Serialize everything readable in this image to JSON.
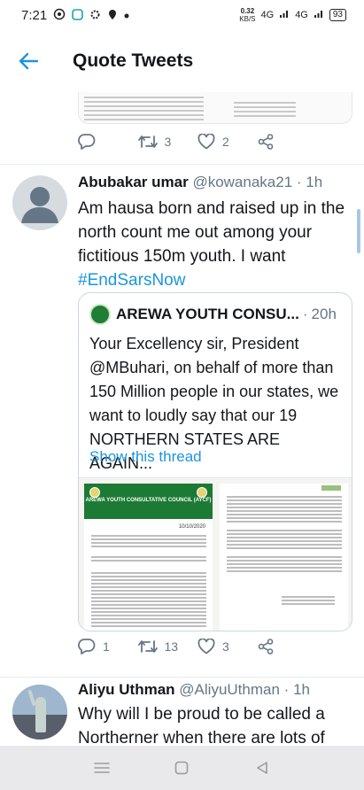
{
  "status_bar": {
    "time": "7:21",
    "speed_value": "0.32",
    "speed_unit": "KB/S",
    "network_1": "4G",
    "network_2": "4G",
    "battery": "93",
    "icons": [
      "whatsapp-icon",
      "app-icon",
      "settings-icon",
      "location-icon",
      "dot-icon"
    ]
  },
  "header": {
    "title": "Quote Tweets",
    "back_icon": "arrow-left-icon"
  },
  "previous_tweet": {
    "reply_count": "",
    "retweet_count": "3",
    "like_count": "2"
  },
  "tweets": [
    {
      "name": "Abubakar umar",
      "handle": "@kowanaka21",
      "separator": "·",
      "time": "1h",
      "text": "Am hausa born and raised up in the north count me out among your fictitious 150m youth. I want",
      "hashtag": "#EndSarsNow",
      "quote": {
        "name": "AREWA YOUTH CONSU...",
        "separator": "·",
        "time": "20h",
        "text": "Your Excellency sir, President @MBuhari, on behalf of more than 150 Million people in our states, we want to loudly say that our 19 NORTHERN STATES ARE AGAIN...",
        "show_thread": "Show this thread",
        "document": {
          "org_name": "AREWA YOUTH CONSULTATIVE COUNCIL (AYCF)",
          "date": "10/10/2020"
        }
      },
      "reply_count": "1",
      "retweet_count": "13",
      "like_count": "3"
    },
    {
      "name": "Aliyu Uthman",
      "handle": "@AliyuUthman",
      "separator": "·",
      "time": "1h",
      "text": "Why will I be proud to be called a Northerner when there are lots of people"
    }
  ],
  "colors": {
    "accent": "#1b95e0",
    "text": "#14171a",
    "muted": "#657786",
    "border": "#e6ecf0"
  }
}
